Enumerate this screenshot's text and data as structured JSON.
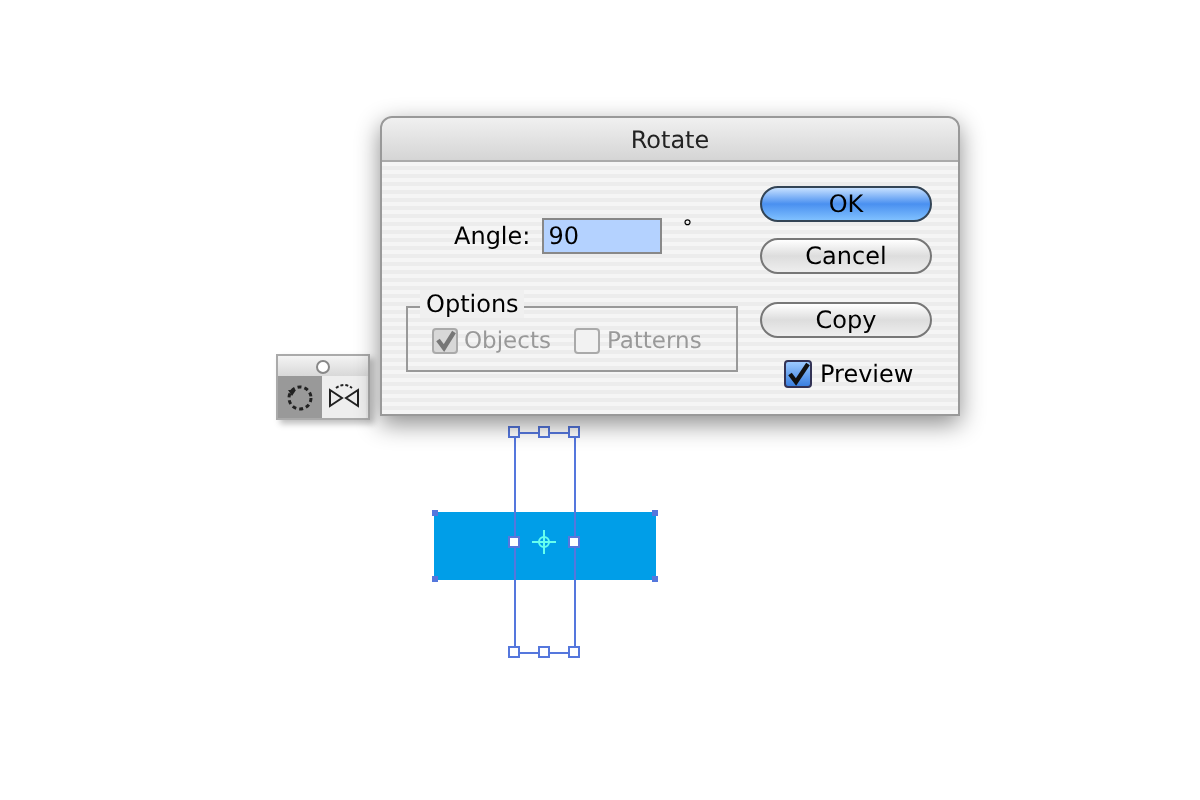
{
  "window": {
    "title": "Rotate"
  },
  "angle": {
    "label": "Angle:",
    "value": "90",
    "unit": "°"
  },
  "options": {
    "title": "Options",
    "items": [
      {
        "label": "Objects",
        "checked": true,
        "disabled": true
      },
      {
        "label": "Patterns",
        "checked": false,
        "disabled": true
      }
    ]
  },
  "buttons": [
    {
      "label": "OK",
      "default": true
    },
    {
      "label": "Cancel",
      "default": false
    },
    {
      "label": "Copy",
      "default": false
    }
  ],
  "preview": {
    "label": "Preview",
    "checked": true
  },
  "tools": [
    {
      "kind": "rotate",
      "selected": true
    },
    {
      "kind": "reflect",
      "selected": false
    }
  ]
}
